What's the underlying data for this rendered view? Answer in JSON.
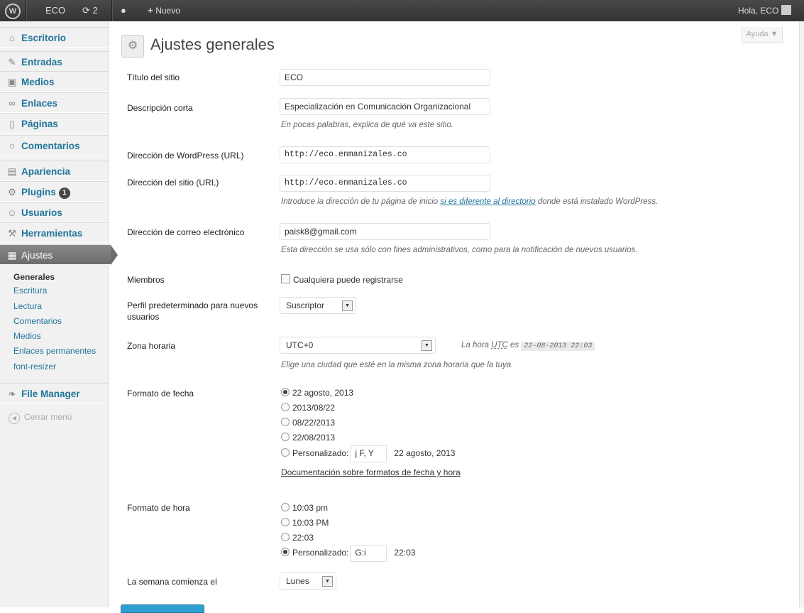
{
  "topbar": {
    "site_name": "ECO",
    "updates_count": "2",
    "new_label": "Nuevo",
    "greeting": "Hola, ECO"
  },
  "sidebar": {
    "items": [
      {
        "label": "Escritorio",
        "icon": "home-icon",
        "glyph": "⌂"
      },
      {
        "label": "Entradas",
        "icon": "pin-icon",
        "glyph": "✎"
      },
      {
        "label": "Medios",
        "icon": "media-icon",
        "glyph": "▣"
      },
      {
        "label": "Enlaces",
        "icon": "link-icon",
        "glyph": "∞"
      },
      {
        "label": "Páginas",
        "icon": "pages-icon",
        "glyph": "▯"
      },
      {
        "label": "Comentarios",
        "icon": "comment-icon",
        "glyph": "○"
      },
      {
        "label": "Apariencia",
        "icon": "appearance-icon",
        "glyph": "▤"
      },
      {
        "label": "Plugins",
        "icon": "plugin-icon",
        "glyph": "⚙",
        "badge": "1"
      },
      {
        "label": "Usuarios",
        "icon": "users-icon",
        "glyph": "☺"
      },
      {
        "label": "Herramientas",
        "icon": "tools-icon",
        "glyph": "⚒"
      },
      {
        "label": "Ajustes",
        "icon": "settings-icon",
        "glyph": "▦"
      }
    ],
    "submenu": [
      "Generales",
      "Escritura",
      "Lectura",
      "Comentarios",
      "Medios",
      "Enlaces permanentes",
      "font-resizer"
    ],
    "file_manager": "File Manager",
    "collapse": "Cerrar menú"
  },
  "help_label": "Ayuda ▼",
  "page_title": "Ajustes generales",
  "form": {
    "site_title_label": "Título del sitio",
    "site_title": "ECO",
    "tagline_label": "Descripción corta",
    "tagline": "Especialización en Comunicación Organizacional",
    "tagline_desc": "En pocas palabras, explica de qué va este sitio.",
    "wp_url_label": "Dirección de WordPress (URL)",
    "wp_url": "http://eco.enmanizales.co",
    "site_url_label": "Dirección del sitio (URL)",
    "site_url": "http://eco.enmanizales.co",
    "site_url_desc_pre": "Introduce la dirección de tu página de inicio ",
    "site_url_desc_link": "si es diferente al directorio",
    "site_url_desc_post": " donde está instalado WordPress.",
    "email_label": "Dirección de correo electrónico",
    "email": "paisk8@gmail.com",
    "email_desc": "Esta dirección se usa sólo con fines administrativos, como para la notificación de nuevos usuarios.",
    "members_label": "Miembros",
    "members_checkbox": "Cualquiera puede registrarse",
    "role_label_1": "Perfil predeterminado para nuevos",
    "role_label_2": "usuarios",
    "role_value": "Suscriptor",
    "tz_label": "Zona horaria",
    "tz_value": "UTC+0",
    "tz_note_pre": "La hora ",
    "tz_note_abbr": "UTC",
    "tz_note_mid": " es ",
    "tz_time": "22-08-2013 22:03",
    "tz_desc": "Elige una ciudad que esté en la misma zona horaria que la tuya.",
    "date_label": "Formato de fecha",
    "date_options": [
      "22 agosto, 2013",
      "2013/08/22",
      "08/22/2013",
      "22/08/2013"
    ],
    "custom_label": "Personalizado:",
    "date_custom_value": "j F, Y",
    "date_custom_preview": "22 agosto, 2013",
    "date_doc_link": "Documentación sobre formatos de fecha y hora",
    "time_label": "Formato de hora",
    "time_options": [
      "10:03 pm",
      "10:03 PM",
      "22:03"
    ],
    "time_custom_value": "G:i",
    "time_custom_preview": "22:03",
    "week_label": "La semana comienza el",
    "week_value": "Lunes"
  }
}
